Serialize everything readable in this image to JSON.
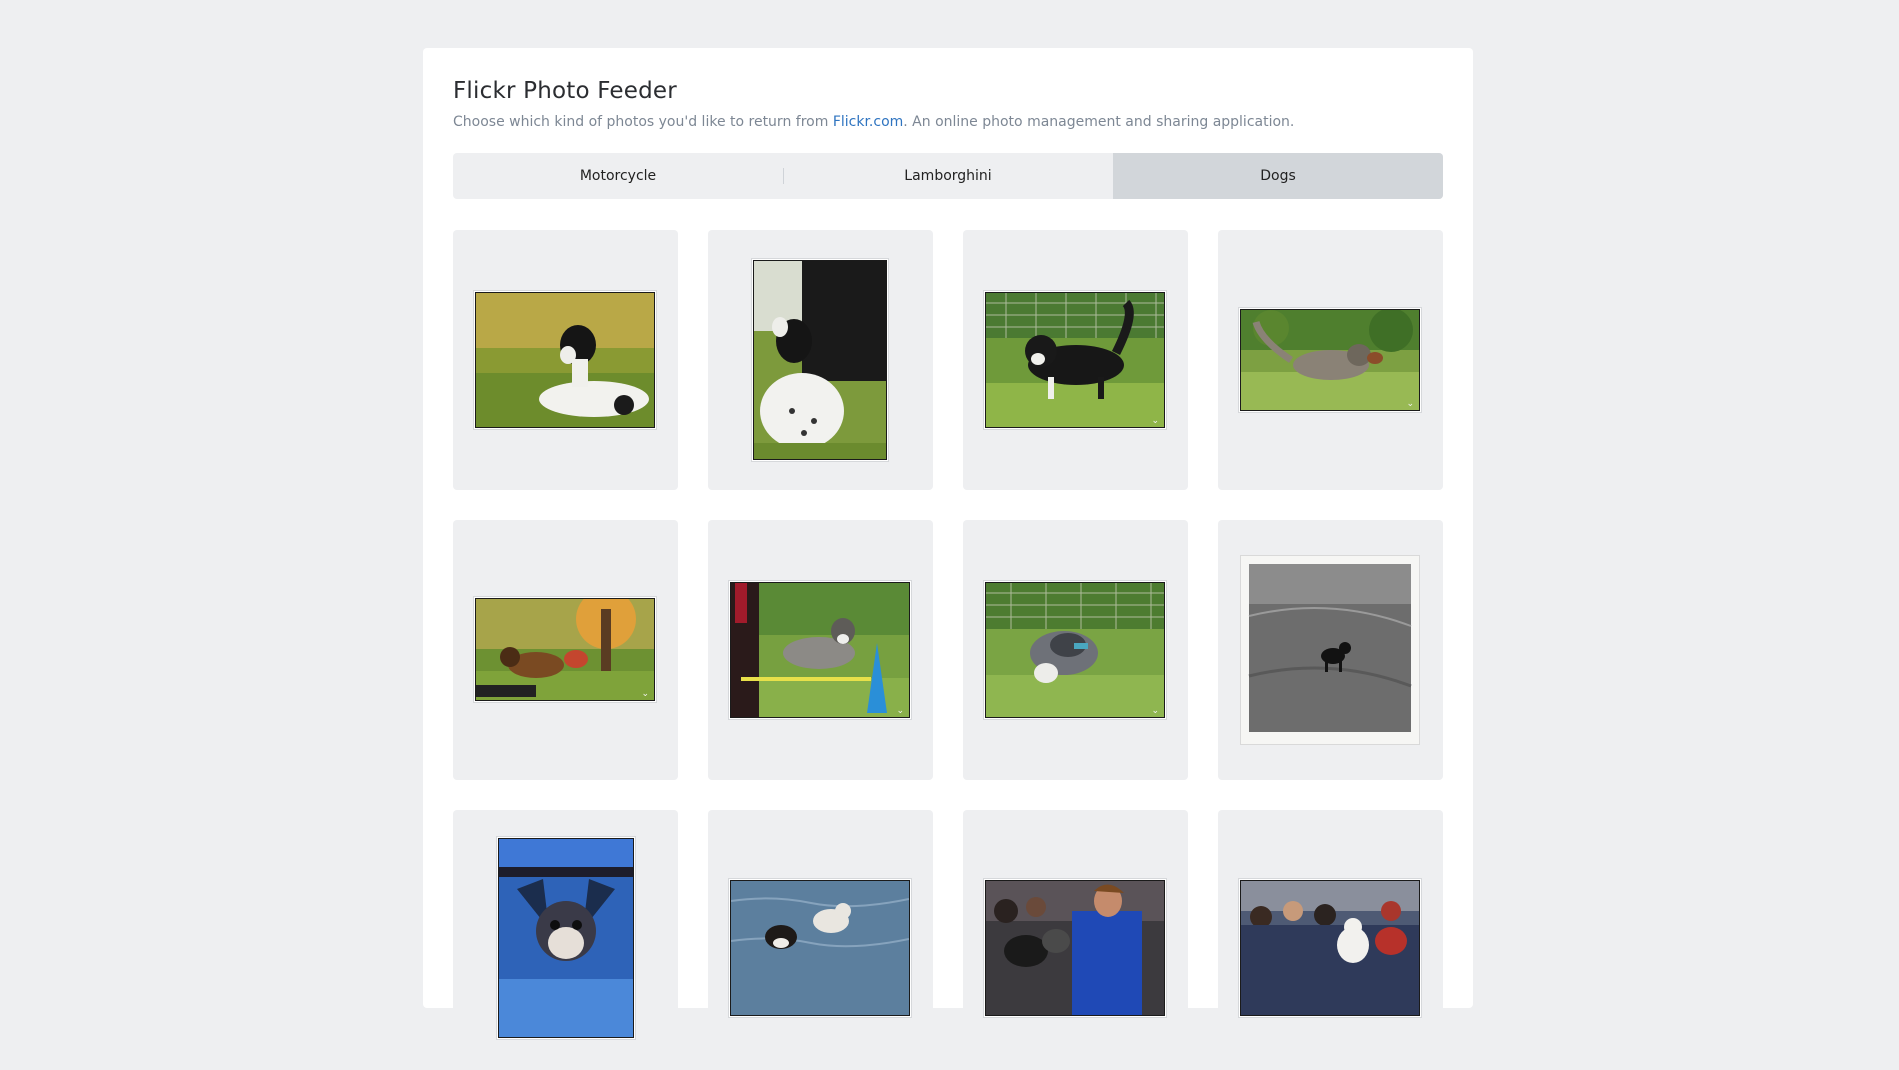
{
  "app": {
    "title": "Flickr Photo Feeder",
    "subtitle_before": "Choose which kind of photos you'd like to return from ",
    "subtitle_link": "Flickr.com",
    "subtitle_after": ". An online photo management and sharing application."
  },
  "tabs": [
    {
      "label": "Motorcycle",
      "active": false
    },
    {
      "label": "Lamborghini",
      "active": false
    },
    {
      "label": "Dogs",
      "active": true
    }
  ],
  "photos": [
    {
      "subject": "black-and-white-dog-lying-in-grass"
    },
    {
      "subject": "dog-looking-up-at-owner"
    },
    {
      "subject": "black-and-white-dog-walking-on-grass"
    },
    {
      "subject": "husky-carrying-toy"
    },
    {
      "subject": "dogs-at-training-obstacle"
    },
    {
      "subject": "husky-jumping-agility-bar"
    },
    {
      "subject": "merle-dog-sniffing-grass"
    },
    {
      "subject": "black-dog-in-field-monochrome"
    },
    {
      "subject": "dog-mural-graffiti"
    },
    {
      "subject": "dogs-swimming-in-water"
    },
    {
      "subject": "woman-with-dogs-in-crowd"
    },
    {
      "subject": "people-with-white-dog-in-crowd"
    }
  ],
  "colors": {
    "background": "#eeeff1",
    "card": "#ffffff",
    "link": "#2f74c0",
    "active_tab": "#d2d6da"
  }
}
